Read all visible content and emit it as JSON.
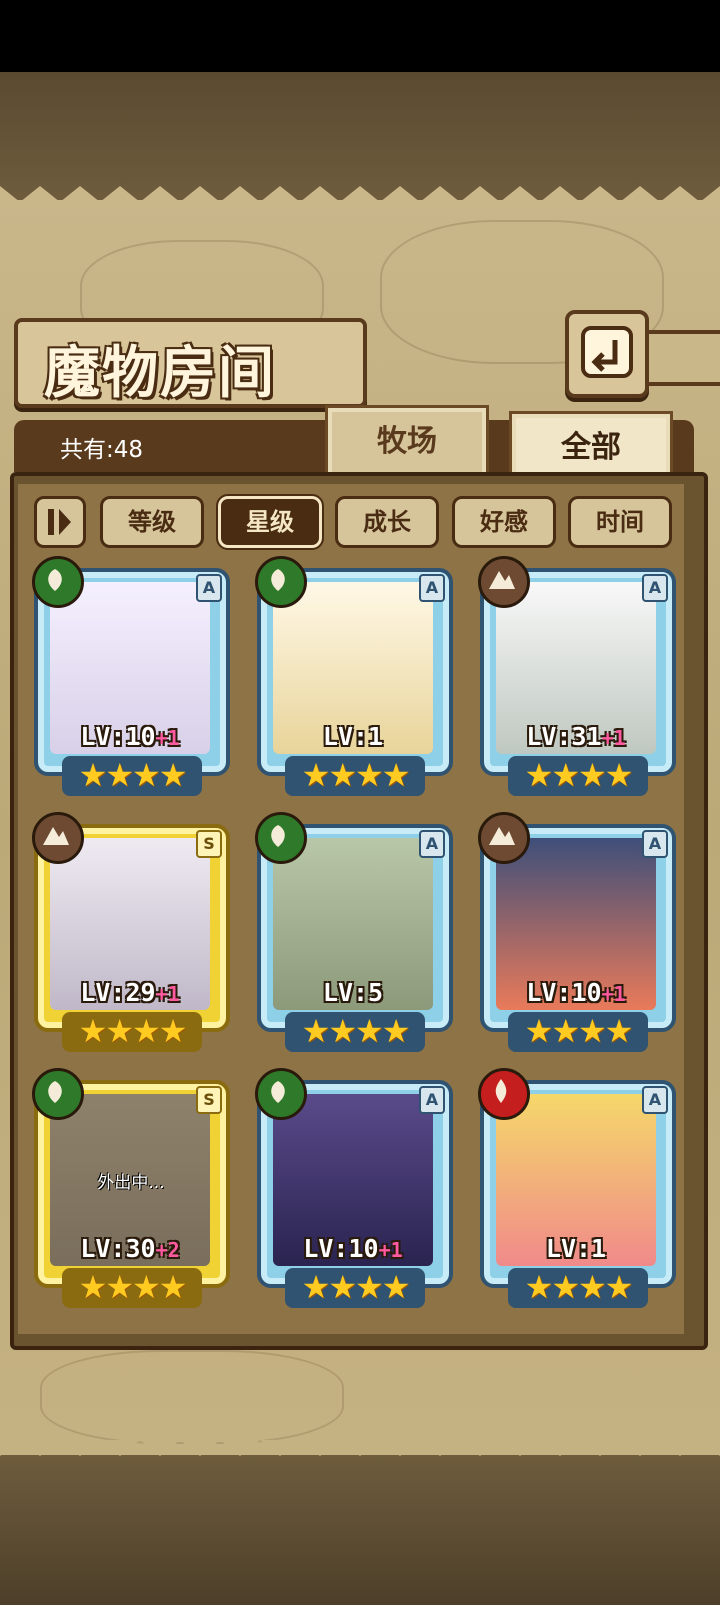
{
  "header": {
    "title": "魔物房间"
  },
  "count": {
    "label": "共有:48"
  },
  "tabs": [
    {
      "label": "牧场",
      "active": false
    },
    {
      "label": "全部",
      "active": true
    }
  ],
  "sort": [
    {
      "label": "等级",
      "active": false
    },
    {
      "label": "星级",
      "active": true
    },
    {
      "label": "成长",
      "active": false
    },
    {
      "label": "好感",
      "active": false
    },
    {
      "label": "时间",
      "active": false
    }
  ],
  "monsters": [
    {
      "level": "LV:10",
      "bonus": "+1",
      "rank": "A",
      "element": "nature",
      "stars": "★★★★",
      "color": "#e8e4f0"
    },
    {
      "level": "LV:1",
      "bonus": "",
      "rank": "A",
      "element": "nature",
      "stars": "★★★★",
      "color": "#f3e2b3"
    },
    {
      "level": "LV:31",
      "bonus": "+1",
      "rank": "A",
      "element": "earth",
      "stars": "★★★★",
      "color": "#ececec"
    },
    {
      "level": "LV:29",
      "bonus": "+1",
      "rank": "S",
      "element": "earth",
      "stars": "★★★★",
      "color": "#e6e0ea"
    },
    {
      "level": "LV:5",
      "bonus": "",
      "rank": "A",
      "element": "nature",
      "stars": "★★★★",
      "color": "#e8cf8e"
    },
    {
      "level": "LV:10",
      "bonus": "+1",
      "rank": "A",
      "element": "earth",
      "stars": "★★★★",
      "color": "#f08a6a"
    },
    {
      "level": "LV:30",
      "bonus": "+2",
      "rank": "S",
      "element": "nature",
      "stars": "★★★★",
      "color": "#8c8474",
      "status": "外出中..."
    },
    {
      "level": "LV:10",
      "bonus": "+1",
      "rank": "A",
      "element": "nature",
      "stars": "★★★★",
      "color": "#3a2f5c"
    },
    {
      "level": "LV:1",
      "bonus": "",
      "rank": "A",
      "element": "fire",
      "stars": "★★★★",
      "color": "#f7a0a0"
    }
  ]
}
